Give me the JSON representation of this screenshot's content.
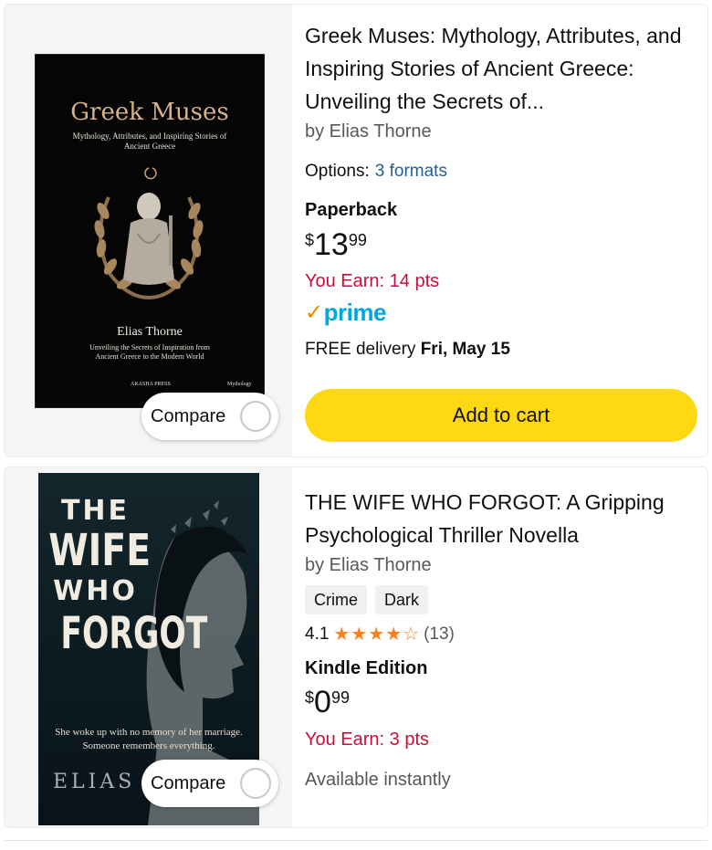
{
  "compare_label": "Compare",
  "products": [
    {
      "title": "Greek Muses: Mythology, Attributes, and Inspiring Stories of Ancient Greece: Unveiling the Secrets of...",
      "author": "by Elias Thorne",
      "options_label": "Options:",
      "options_link": "3 formats",
      "format": "Paperback",
      "price_currency": "$",
      "price_whole": "13",
      "price_fraction": "99",
      "earn": "You Earn: 14 pts",
      "prime_label": "prime",
      "delivery_prefix": "FREE delivery",
      "delivery_date": "Fri, May 15",
      "add_to_cart": "Add to cart",
      "cover": {
        "title": "Greek Muses",
        "subtitle": "Mythology, Attributes, and Inspiring Stories of Ancient Greece",
        "author": "Elias Thorne",
        "tagline": "Unveiling the Secrets of Inspiration from Ancient Greece to the Modern World",
        "publisher": "AKASHA PRESS",
        "category": "Mythology"
      }
    },
    {
      "title": "THE WIFE WHO FORGOT: A Gripping Psychological Thriller Novella",
      "author": "by Elias Thorne",
      "tags": [
        "Crime",
        "Dark"
      ],
      "rating_value": "4.1",
      "rating_stars": 4.1,
      "rating_count": "(13)",
      "format": "Kindle Edition",
      "price_currency": "$",
      "price_whole": "0",
      "price_fraction": "99",
      "earn": "You Earn: 3 pts",
      "availability": "Available instantly",
      "cover": {
        "line1": "THE",
        "line2": "WIFE",
        "line3": "WHO",
        "line4": "FORGOT",
        "blurb1": "She woke up with no memory of her marriage.",
        "blurb2": "Someone remembers everything.",
        "author": "ELIAS T"
      }
    }
  ],
  "colors": {
    "add_to_cart": "#ffd814",
    "earn_red": "#cc0c39",
    "link_blue": "#1f5f99",
    "prime_blue": "#00a8e1",
    "prime_check": "#f08804",
    "star_orange": "#f5821f"
  }
}
